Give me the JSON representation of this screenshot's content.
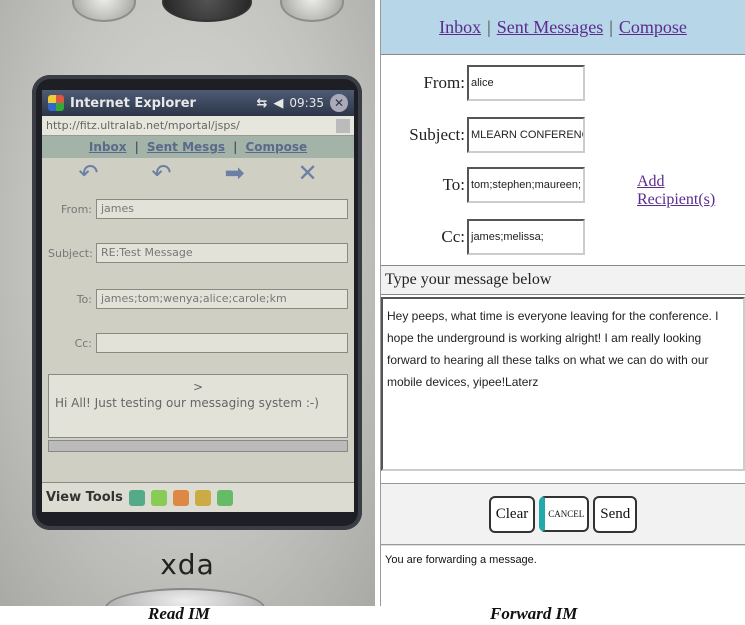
{
  "device": {
    "brand": "xda",
    "browser_title": "Internet Explorer",
    "clock": "09:35",
    "address": "http://fitz.ultralab.net/mportal/jsps/",
    "nav": {
      "inbox": "Inbox",
      "sent": "Sent Mesgs",
      "compose": "Compose",
      "sep": "|"
    },
    "from_label": "From:",
    "from_value": "james",
    "subject_label": "Subject:",
    "subject_value": "RE:Test Message",
    "to_label": "To:",
    "to_value": "james;tom;wenya;alice;carole;km",
    "cc_label": "Cc:",
    "cc_value": "",
    "message_caret": ">",
    "message_text": "Hi All! Just testing our messaging system :-)",
    "menu_label": "View Tools",
    "icons": [
      "windows-flag-icon",
      "signal-icon",
      "volume-icon",
      "close-icon",
      "reply-icon",
      "reply-all-icon",
      "forward-icon",
      "delete-icon"
    ]
  },
  "forward_form": {
    "nav": {
      "inbox": "Inbox",
      "sent": "Sent Messages",
      "compose": "Compose",
      "sep": "|"
    },
    "from_label": "From:",
    "from_value": "alice",
    "subject_label": "Subject:",
    "subject_value": "MLEARN CONFERENCE",
    "to_label": "To:",
    "to_value": "tom;stephen;maureen;",
    "cc_label": "Cc:",
    "cc_value": "james;melissa;",
    "add_recipients": "Add Recipient(s)",
    "message_heading": "Type your message below",
    "message_body": "Hey peeps, what time is everyone leaving for the conference. I hope the underground is working alright! I am really looking forward to hearing all these talks on what we can do with our mobile devices, yipee!Laterz",
    "clear_label": "Clear",
    "cancel_label": "CANCEL",
    "send_label": "Send",
    "status": "You are forwarding a message."
  },
  "captions": {
    "left": "Read IM",
    "right": "Forward IM"
  },
  "colors": {
    "nav_bg": "#b7d7e8",
    "link": "#5b2b8f"
  }
}
